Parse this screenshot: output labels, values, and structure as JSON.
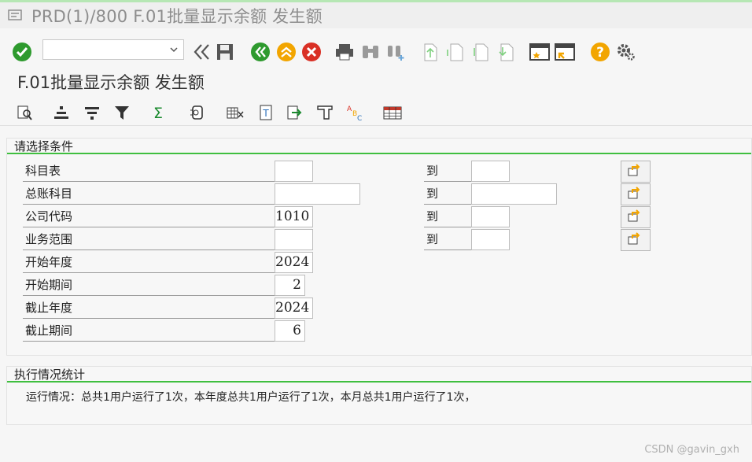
{
  "window": {
    "title": "PRD(1)/800 F.01批量显示余额 发生额"
  },
  "toolbar": {
    "command_value": "",
    "icons": [
      "check-icon",
      "command-dropdown-icon",
      "double-left-icon",
      "save-icon",
      "back-icon",
      "exit-icon",
      "cancel-icon",
      "print-icon",
      "find-icon",
      "find-next-icon",
      "first-page-icon",
      "previous-page-icon",
      "next-page-icon",
      "last-page-icon",
      "new-session-icon",
      "shortcut-icon",
      "help-icon",
      "settings-icon"
    ]
  },
  "page": {
    "title": "F.01批量显示余额 发生额"
  },
  "app_toolbar": {
    "icons": [
      "get-variant-icon",
      "sort-ascending-icon",
      "sort-descending-icon",
      "filter-icon",
      "sum-icon",
      "details-icon",
      "export-excel-icon",
      "text-icon",
      "export-icon",
      "layout-icon",
      "abc-icon",
      "table-icon"
    ]
  },
  "selection": {
    "heading": "请选择条件",
    "to_label": "到",
    "rows": [
      {
        "label": "科目表",
        "from": "",
        "to": ""
      },
      {
        "label": "总账科目",
        "from": "",
        "to": ""
      },
      {
        "label": "公司代码",
        "from": "1010",
        "to": ""
      },
      {
        "label": "业务范围",
        "from": "",
        "to": ""
      }
    ],
    "single_rows": [
      {
        "label": "开始年度",
        "value": "2024"
      },
      {
        "label": "开始期间",
        "value": "2"
      },
      {
        "label": "截止年度",
        "value": "2024"
      },
      {
        "label": "截止期间",
        "value": "6"
      }
    ]
  },
  "stats": {
    "heading": "执行情况统计",
    "text": "运行情况：总共1用户运行了1次，本年度总共1用户运行了1次，本月总共1用户运行了1次，"
  },
  "watermark": "CSDN @gavin_gxh",
  "colors": {
    "accent_green": "#3fbf3f",
    "ok_green": "#2e9a2e",
    "cancel_red": "#d93025",
    "orange": "#f2a500"
  }
}
